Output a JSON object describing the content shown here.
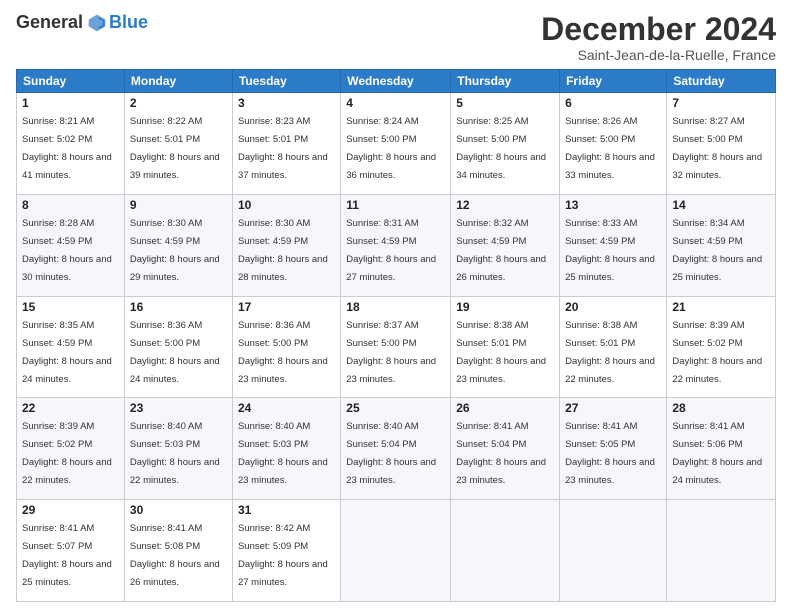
{
  "logo": {
    "general": "General",
    "blue": "Blue"
  },
  "header": {
    "month": "December 2024",
    "location": "Saint-Jean-de-la-Ruelle, France"
  },
  "weekdays": [
    "Sunday",
    "Monday",
    "Tuesday",
    "Wednesday",
    "Thursday",
    "Friday",
    "Saturday"
  ],
  "weeks": [
    [
      {
        "day": "1",
        "sunrise": "8:21 AM",
        "sunset": "5:02 PM",
        "daylight": "8 hours and 41 minutes."
      },
      {
        "day": "2",
        "sunrise": "8:22 AM",
        "sunset": "5:01 PM",
        "daylight": "8 hours and 39 minutes."
      },
      {
        "day": "3",
        "sunrise": "8:23 AM",
        "sunset": "5:01 PM",
        "daylight": "8 hours and 37 minutes."
      },
      {
        "day": "4",
        "sunrise": "8:24 AM",
        "sunset": "5:00 PM",
        "daylight": "8 hours and 36 minutes."
      },
      {
        "day": "5",
        "sunrise": "8:25 AM",
        "sunset": "5:00 PM",
        "daylight": "8 hours and 34 minutes."
      },
      {
        "day": "6",
        "sunrise": "8:26 AM",
        "sunset": "5:00 PM",
        "daylight": "8 hours and 33 minutes."
      },
      {
        "day": "7",
        "sunrise": "8:27 AM",
        "sunset": "5:00 PM",
        "daylight": "8 hours and 32 minutes."
      }
    ],
    [
      {
        "day": "8",
        "sunrise": "8:28 AM",
        "sunset": "4:59 PM",
        "daylight": "8 hours and 30 minutes."
      },
      {
        "day": "9",
        "sunrise": "8:30 AM",
        "sunset": "4:59 PM",
        "daylight": "8 hours and 29 minutes."
      },
      {
        "day": "10",
        "sunrise": "8:30 AM",
        "sunset": "4:59 PM",
        "daylight": "8 hours and 28 minutes."
      },
      {
        "day": "11",
        "sunrise": "8:31 AM",
        "sunset": "4:59 PM",
        "daylight": "8 hours and 27 minutes."
      },
      {
        "day": "12",
        "sunrise": "8:32 AM",
        "sunset": "4:59 PM",
        "daylight": "8 hours and 26 minutes."
      },
      {
        "day": "13",
        "sunrise": "8:33 AM",
        "sunset": "4:59 PM",
        "daylight": "8 hours and 25 minutes."
      },
      {
        "day": "14",
        "sunrise": "8:34 AM",
        "sunset": "4:59 PM",
        "daylight": "8 hours and 25 minutes."
      }
    ],
    [
      {
        "day": "15",
        "sunrise": "8:35 AM",
        "sunset": "4:59 PM",
        "daylight": "8 hours and 24 minutes."
      },
      {
        "day": "16",
        "sunrise": "8:36 AM",
        "sunset": "5:00 PM",
        "daylight": "8 hours and 24 minutes."
      },
      {
        "day": "17",
        "sunrise": "8:36 AM",
        "sunset": "5:00 PM",
        "daylight": "8 hours and 23 minutes."
      },
      {
        "day": "18",
        "sunrise": "8:37 AM",
        "sunset": "5:00 PM",
        "daylight": "8 hours and 23 minutes."
      },
      {
        "day": "19",
        "sunrise": "8:38 AM",
        "sunset": "5:01 PM",
        "daylight": "8 hours and 23 minutes."
      },
      {
        "day": "20",
        "sunrise": "8:38 AM",
        "sunset": "5:01 PM",
        "daylight": "8 hours and 22 minutes."
      },
      {
        "day": "21",
        "sunrise": "8:39 AM",
        "sunset": "5:02 PM",
        "daylight": "8 hours and 22 minutes."
      }
    ],
    [
      {
        "day": "22",
        "sunrise": "8:39 AM",
        "sunset": "5:02 PM",
        "daylight": "8 hours and 22 minutes."
      },
      {
        "day": "23",
        "sunrise": "8:40 AM",
        "sunset": "5:03 PM",
        "daylight": "8 hours and 22 minutes."
      },
      {
        "day": "24",
        "sunrise": "8:40 AM",
        "sunset": "5:03 PM",
        "daylight": "8 hours and 23 minutes."
      },
      {
        "day": "25",
        "sunrise": "8:40 AM",
        "sunset": "5:04 PM",
        "daylight": "8 hours and 23 minutes."
      },
      {
        "day": "26",
        "sunrise": "8:41 AM",
        "sunset": "5:04 PM",
        "daylight": "8 hours and 23 minutes."
      },
      {
        "day": "27",
        "sunrise": "8:41 AM",
        "sunset": "5:05 PM",
        "daylight": "8 hours and 23 minutes."
      },
      {
        "day": "28",
        "sunrise": "8:41 AM",
        "sunset": "5:06 PM",
        "daylight": "8 hours and 24 minutes."
      }
    ],
    [
      {
        "day": "29",
        "sunrise": "8:41 AM",
        "sunset": "5:07 PM",
        "daylight": "8 hours and 25 minutes."
      },
      {
        "day": "30",
        "sunrise": "8:41 AM",
        "sunset": "5:08 PM",
        "daylight": "8 hours and 26 minutes."
      },
      {
        "day": "31",
        "sunrise": "8:42 AM",
        "sunset": "5:09 PM",
        "daylight": "8 hours and 27 minutes."
      },
      null,
      null,
      null,
      null
    ]
  ]
}
